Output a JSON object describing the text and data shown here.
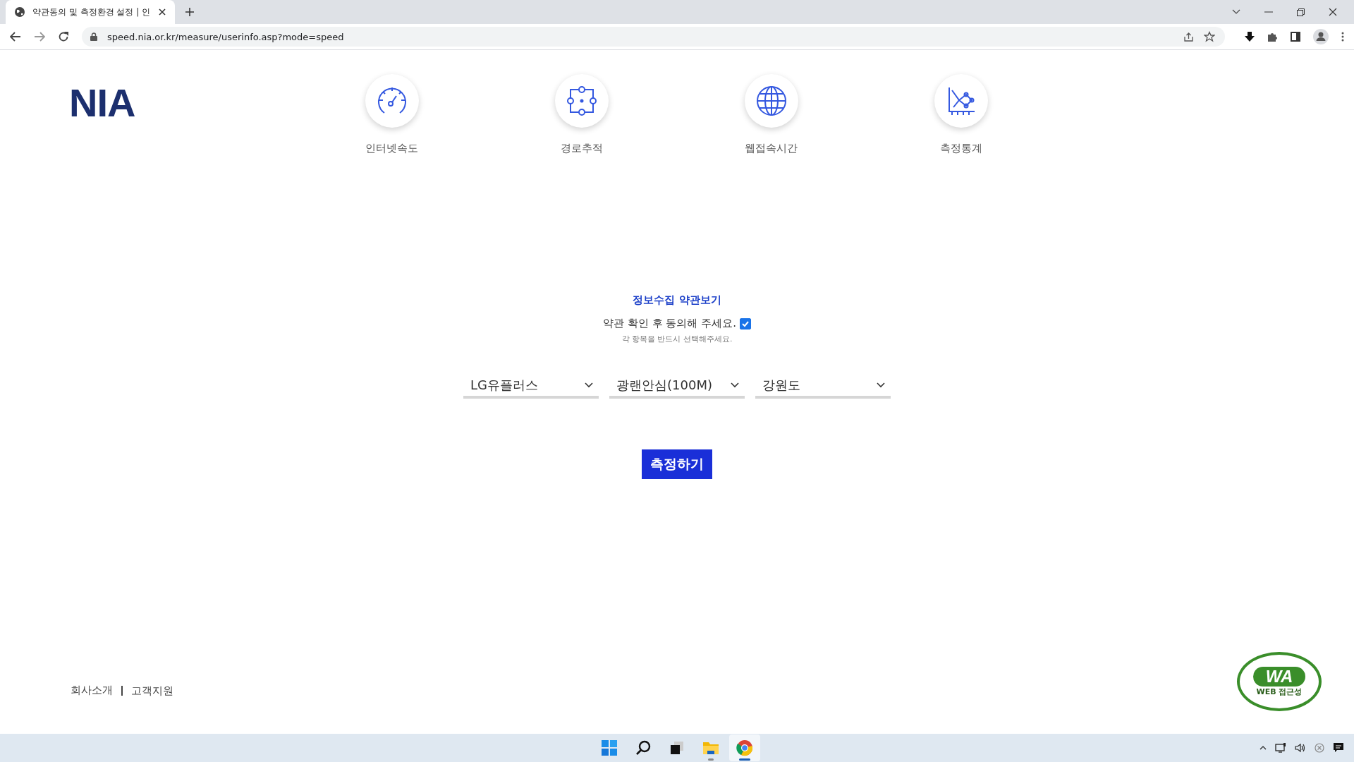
{
  "browser": {
    "tab": {
      "title": "약관동의 및 측정환경 설정 | 인",
      "selected": true
    },
    "url": "speed.nia.or.kr/measure/userinfo.asp?mode=speed"
  },
  "logo": "NIA",
  "nav": [
    {
      "label": "인터넷속도",
      "kind": "speed"
    },
    {
      "label": "경로추적",
      "kind": "route"
    },
    {
      "label": "웹접속시간",
      "kind": "web"
    },
    {
      "label": "측정통계",
      "kind": "stats"
    }
  ],
  "form": {
    "title": "정보수집 약관보기",
    "agree": {
      "label": "약관 확인 후 동의해 주세요.",
      "checked": true
    },
    "hint": "각 항목을 반드시 선택해주세요.",
    "selects": [
      {
        "value": "LG유플러스"
      },
      {
        "value": "광랜안심(100M)"
      },
      {
        "value": "강원도"
      }
    ],
    "button": "측정하기"
  },
  "footer": {
    "links": [
      "회사소개",
      "고객지원"
    ]
  },
  "badge": {
    "mark": "WA",
    "caption": "WEB 접근성"
  },
  "taskbar": {
    "apps": [
      {
        "kind": "start",
        "selected": false,
        "running": false
      },
      {
        "kind": "search",
        "selected": false,
        "running": false
      },
      {
        "kind": "taskview",
        "selected": false,
        "running": false
      },
      {
        "kind": "files",
        "selected": false,
        "running": true
      },
      {
        "kind": "browser",
        "selected": true,
        "running": true
      }
    ]
  }
}
